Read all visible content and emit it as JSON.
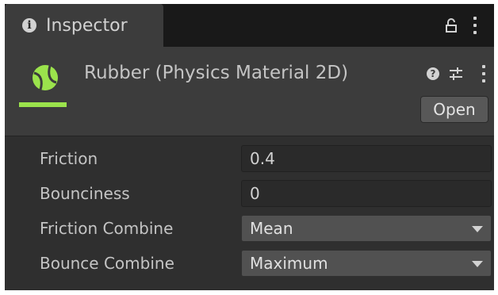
{
  "tab": {
    "label": "Inspector",
    "icon": "info-icon"
  },
  "header": {
    "title": "Rubber (Physics Material 2D)",
    "asset_icon": "physics-material-2d-icon",
    "accent_color": "#9be34c",
    "help_symbol": "?",
    "open_label": "Open"
  },
  "properties": {
    "friction": {
      "label": "Friction",
      "value": "0.4"
    },
    "bounciness": {
      "label": "Bounciness",
      "value": "0"
    },
    "friction_combine": {
      "label": "Friction Combine",
      "value": "Mean"
    },
    "bounce_combine": {
      "label": "Bounce Combine",
      "value": "Maximum"
    }
  }
}
